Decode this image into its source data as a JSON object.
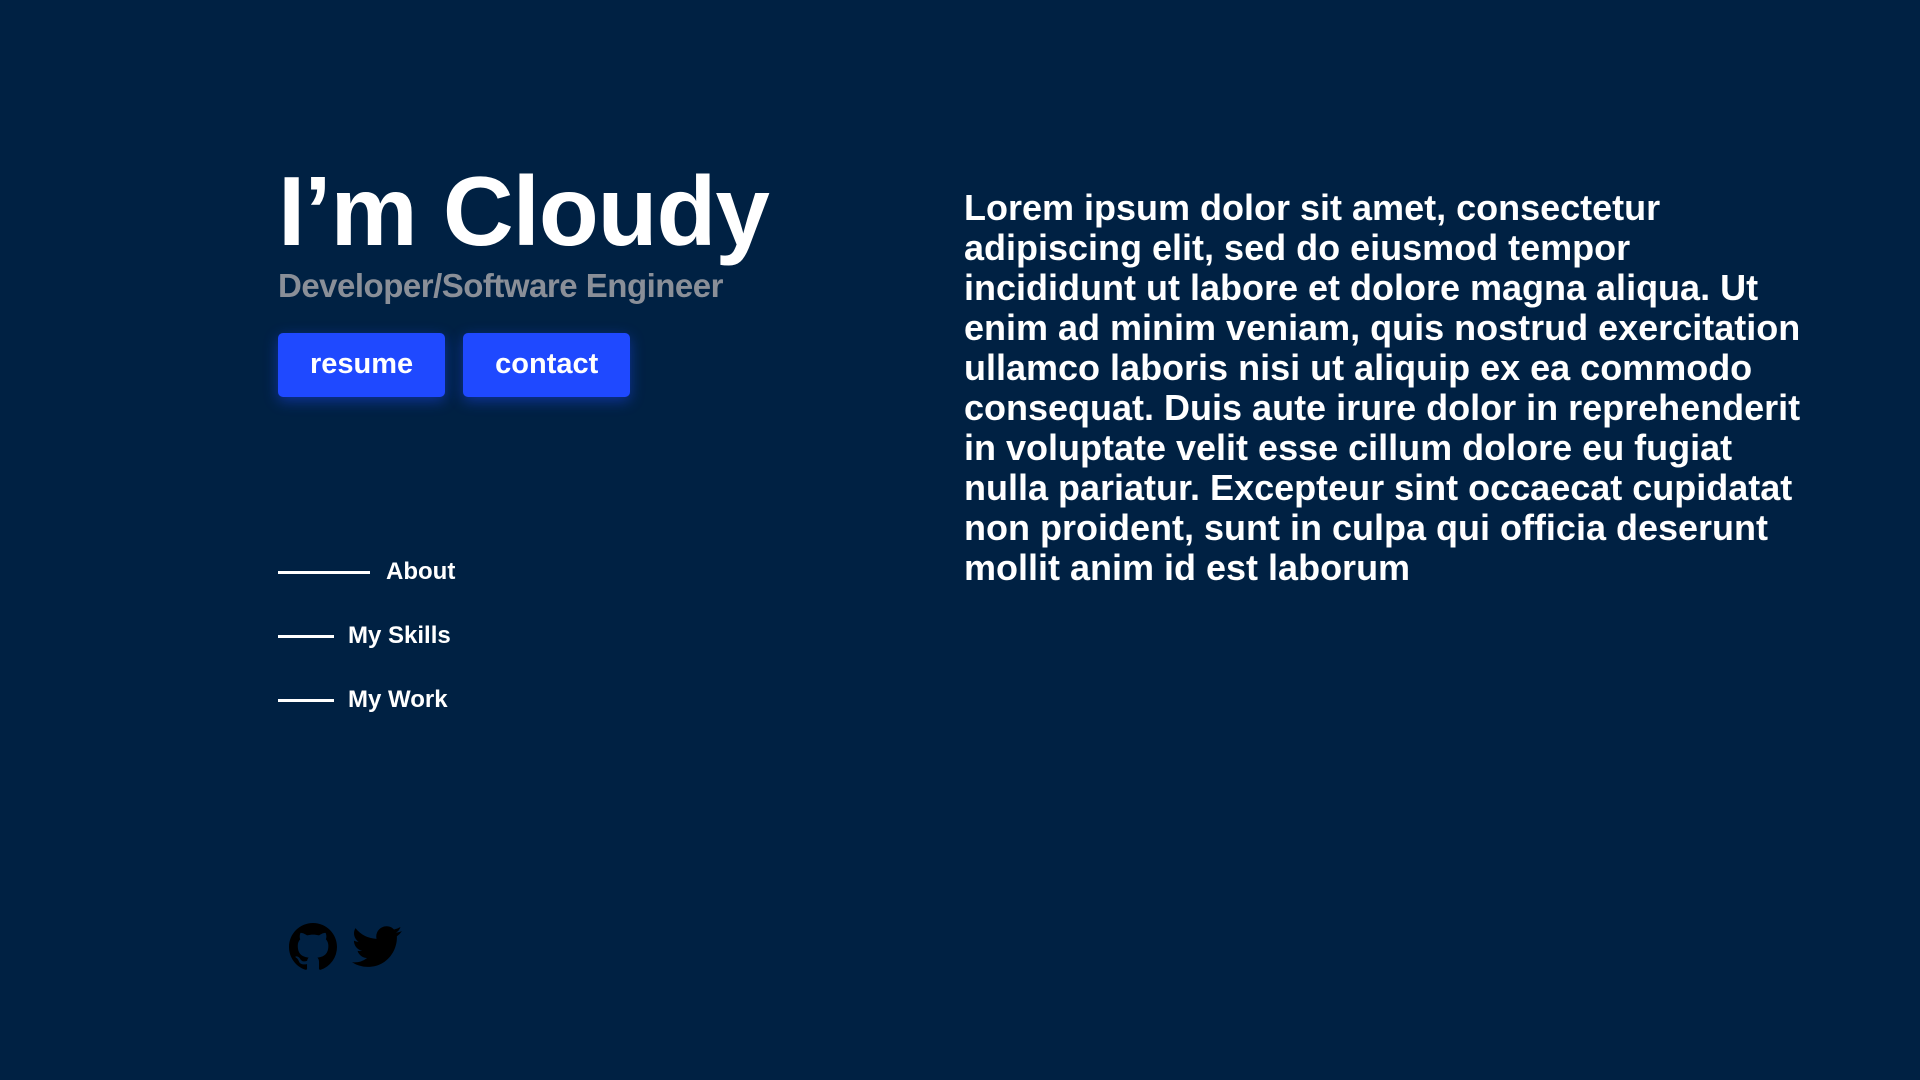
{
  "hero": {
    "title": "I’m Cloudy",
    "subtitle": "Developer/Software Engineer",
    "buttons": {
      "resume_label": "resume",
      "contact_label": "contact"
    }
  },
  "nav": {
    "items": [
      {
        "label": "About"
      },
      {
        "label": "My Skills"
      },
      {
        "label": "My Work"
      }
    ]
  },
  "social": {
    "icons": [
      "github-icon",
      "twitter-icon"
    ]
  },
  "about": {
    "text": "Lorem ipsum dolor sit amet, consectetur adipiscing elit, sed do eiusmod tempor incididunt ut labore et dolore magna aliqua. Ut enim ad minim veniam, quis nostrud exercitation ullamco laboris nisi ut aliquip ex ea commodo consequat. Duis aute irure dolor in reprehenderit in voluptate velit esse cillum dolore eu fugiat nulla pariatur. Excepteur sint occaecat cupidatat non proident, sunt in culpa qui officia deserunt mollit anim id est laborum"
  },
  "colors": {
    "background": "#002143",
    "accent": "#1f49ff",
    "subtitle": "#8a8f98",
    "text": "#ffffff",
    "icon": "#000000"
  }
}
